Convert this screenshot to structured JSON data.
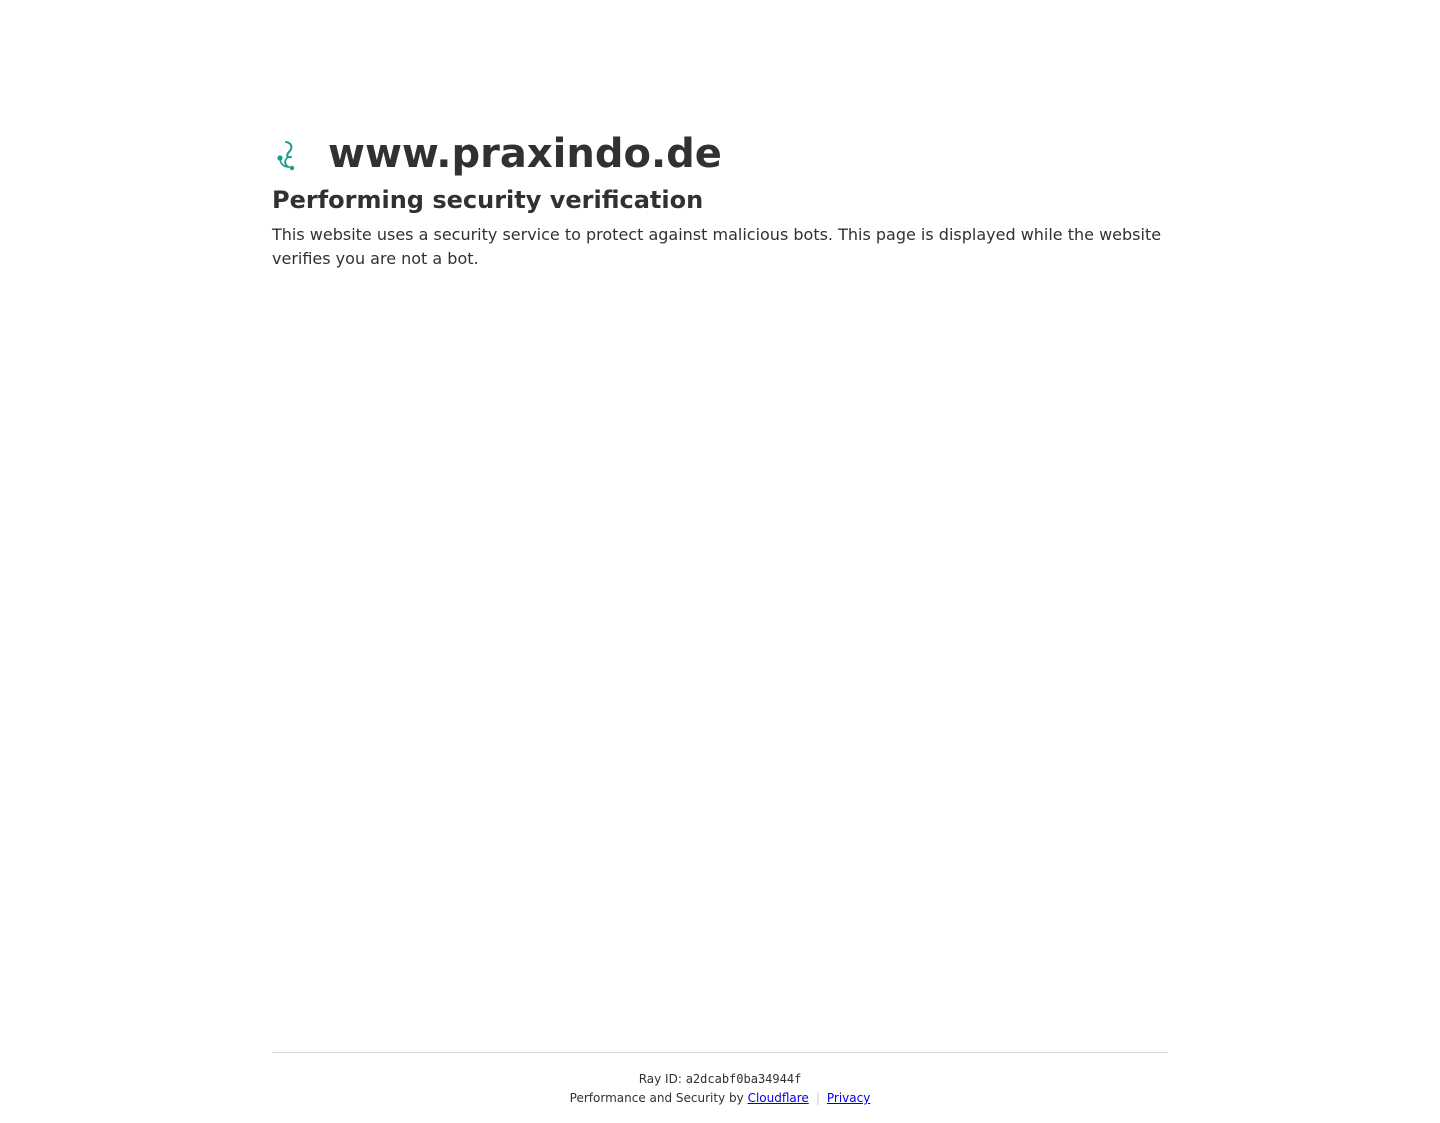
{
  "header": {
    "site_name": "www.praxindo.de",
    "favicon_icon": "stethoscope-icon",
    "favicon_color": "#1a9b8c"
  },
  "main": {
    "heading": "Performing security verification",
    "description": "This website uses a security service to protect against malicious bots. This page is displayed while the website verifies you are not a bot."
  },
  "footer": {
    "ray_label": "Ray ID:",
    "ray_id": "a2dcabf0ba34944f",
    "performance_label": "Performance and Security by",
    "cloudflare_link": "Cloudflare",
    "separator": "|",
    "privacy_link": "Privacy",
    "link_color": "#0000ee"
  }
}
